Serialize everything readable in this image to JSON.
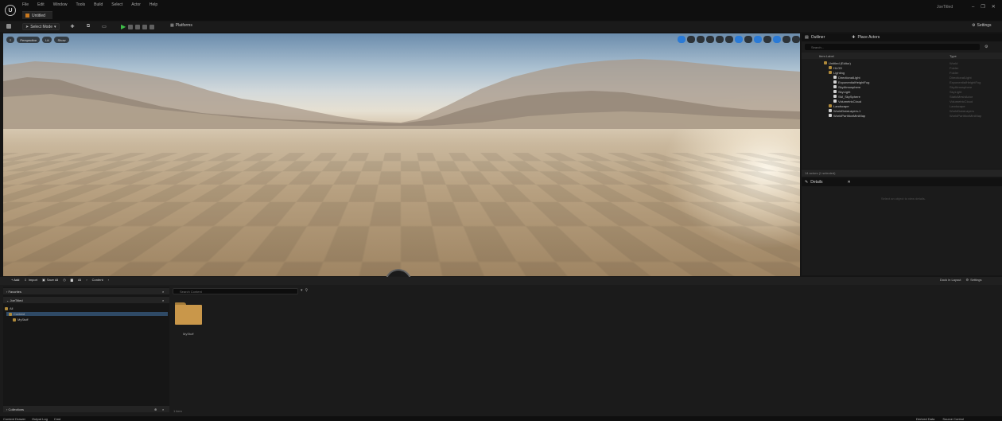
{
  "titlebar": {
    "logo_text": "U",
    "menu": [
      "File",
      "Edit",
      "Window",
      "Tools",
      "Build",
      "Select",
      "Actor",
      "Help"
    ],
    "project_tab": "Untitled",
    "user": "JoeTitled",
    "window_controls": [
      "–",
      "❐",
      "✕"
    ]
  },
  "toolbar": {
    "select_mode": "Select Mode",
    "platforms": "Platforms",
    "settings": "Settings"
  },
  "viewport": {
    "perspective": "Perspective",
    "lit": "Lit",
    "show": "Show"
  },
  "outliner": {
    "tab_outliner": "Outliner",
    "tab_place_actors": "Place Actors",
    "search_placeholder": "Search...",
    "col_label": "Item Label",
    "col_type": "Type",
    "items": [
      {
        "label": "Untitled (Editor)",
        "type": "World",
        "indent": 0,
        "icon": "world-icon"
      },
      {
        "label": "HLOD",
        "type": "Folder",
        "indent": 1,
        "icon": "folder-icon"
      },
      {
        "label": "Lighting",
        "type": "Folder",
        "indent": 1,
        "icon": "folder-icon"
      },
      {
        "label": "DirectionalLight",
        "type": "DirectionalLight",
        "indent": 2,
        "icon": "light-icon"
      },
      {
        "label": "ExponentialHeightFog",
        "type": "ExponentialHeightFog",
        "indent": 2,
        "icon": "light-icon"
      },
      {
        "label": "SkyAtmosphere",
        "type": "SkyAtmosphere",
        "indent": 2,
        "icon": "light-icon"
      },
      {
        "label": "SkyLight",
        "type": "SkyLight",
        "indent": 2,
        "icon": "light-icon"
      },
      {
        "label": "SM_SkySphere",
        "type": "StaticMeshActor",
        "indent": 2,
        "icon": "light-icon"
      },
      {
        "label": "VolumetricCloud",
        "type": "VolumetricCloud",
        "indent": 2,
        "icon": "light-icon"
      },
      {
        "label": "Landscape",
        "type": "Landscape",
        "indent": 1,
        "icon": "folder-icon"
      },
      {
        "label": "WorldDataLayers-1",
        "type": "WorldDataLayers",
        "indent": 1,
        "icon": "light-icon"
      },
      {
        "label": "WorldPartitionMiniMap",
        "type": "WorldPartitionMiniMap",
        "indent": 1,
        "icon": "light-icon"
      }
    ],
    "status": "14 actors (1 selected)"
  },
  "details": {
    "tab": "Details",
    "empty_message": "Select an object to view details."
  },
  "content_browser": {
    "add": "+ Add",
    "import": "Import",
    "save_all": "Save All",
    "path_all": "All",
    "path_content": "Content",
    "dock_in_layout": "Dock in Layout",
    "settings": "Settings",
    "favorites": "Favorites",
    "project_section": "JoeTitled",
    "tree": [
      "All",
      "Content",
      "MyStuff"
    ],
    "search_placeholder": "Search Content",
    "folder_name": "MyStuff",
    "item_count": "1 item",
    "collections": "Collections"
  },
  "statusbar": {
    "content_drawer": "Content Drawer",
    "output_log": "Output Log",
    "cmd": "Cmd",
    "source_control": "Source Control",
    "derived_data": "Derived Data"
  },
  "colors": {
    "play_green": "#3fbf4a",
    "accent_blue": "#2a7ad6",
    "folder": "#c9974a"
  }
}
